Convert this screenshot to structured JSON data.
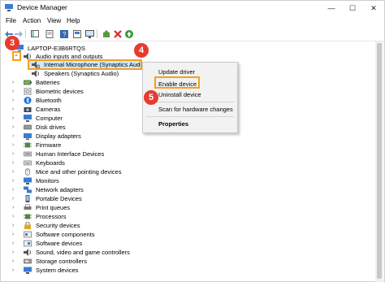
{
  "window": {
    "title": "Device Manager",
    "controls": [
      "—",
      "☐",
      "✕"
    ]
  },
  "menubar": [
    "File",
    "Action",
    "View",
    "Help"
  ],
  "tree": {
    "root": "LAPTOP-E3B6RTQS",
    "category_open": "Audio inputs and outputs",
    "children": [
      "Internal Microphone (Synaptics Audio)",
      "Speakers (Synaptics Audio)"
    ],
    "categories": [
      "Batteries",
      "Biometric devices",
      "Bluetooth",
      "Cameras",
      "Computer",
      "Disk drives",
      "Display adapters",
      "Firmware",
      "Human Interface Devices",
      "Keyboards",
      "Mice and other pointing devices",
      "Monitors",
      "Network adapters",
      "Portable Devices",
      "Print queues",
      "Processors",
      "Security devices",
      "Software components",
      "Software devices",
      "Sound, video and game controllers",
      "Storage controllers",
      "System devices"
    ]
  },
  "context_menu": {
    "items": [
      "Update driver",
      "Enable device",
      "Uninstall device",
      "Scan for hardware changes",
      "Properties"
    ]
  },
  "badges": [
    "3",
    "4",
    "5"
  ],
  "colors": {
    "highlight": "#f5a01a",
    "badge": "#e63b2e",
    "selection": "#cce8ff"
  }
}
